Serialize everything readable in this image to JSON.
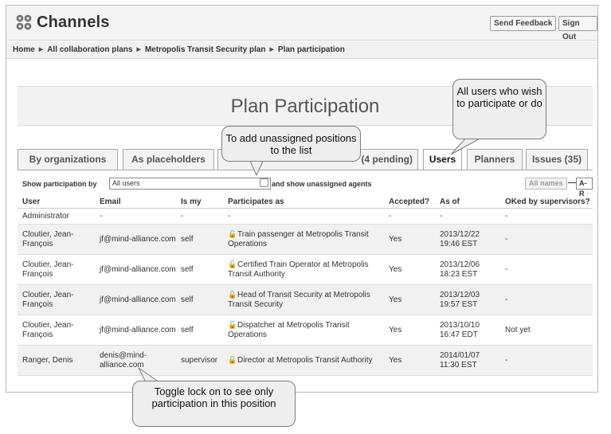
{
  "app": {
    "title": "Channels"
  },
  "header": {
    "send_feedback": "Send Feedback",
    "sign_out": "Sign Out"
  },
  "breadcrumb": [
    "Home",
    "All collaboration plans",
    "Metropolis Transit Security plan",
    "Plan participation"
  ],
  "page": {
    "title": "Plan Participation"
  },
  "tabs": [
    {
      "label": "By organizations",
      "active": false
    },
    {
      "label": "As placeholders",
      "active": false
    },
    {
      "label": "(4 pending)",
      "active": false
    },
    {
      "label": "Users",
      "active": true
    },
    {
      "label": "Planners",
      "active": false
    },
    {
      "label": "Issues (35)",
      "active": false
    }
  ],
  "controls": {
    "show_participation_label": "Show participation by",
    "selected_option": "All users",
    "unassigned_label": "and show unassigned agents",
    "all_names": "All names",
    "dash": "—",
    "range": "A-R"
  },
  "table": {
    "headers": [
      "User",
      "Email",
      "Is my",
      "Participates as",
      "Accepted?",
      "As of",
      "OKed by supervisors?"
    ],
    "rows": [
      {
        "user": "Administrator",
        "email": "-",
        "is_my": "-",
        "participates": "-",
        "accepted": "-",
        "as_of": "-",
        "oked": "-"
      },
      {
        "user": "Cloutier, Jean-François",
        "email": "jf@mind-alliance.com",
        "is_my": "self",
        "participates": "Train passenger at Metropolis Transit Operations",
        "accepted": "Yes",
        "as_of": "2013/12/22 19:46 EST",
        "oked": "-"
      },
      {
        "user": "Cloutier, Jean-François",
        "email": "jf@mind-alliance.com",
        "is_my": "self",
        "participates": "Certified Train Operator at Metropolis Transit Authority",
        "accepted": "Yes",
        "as_of": "2013/12/06 18:23 EST",
        "oked": "-"
      },
      {
        "user": "Cloutier, Jean-François",
        "email": "jf@mind-alliance.com",
        "is_my": "self",
        "participates": "Head of Transit Security at Metropolis Transit Security",
        "accepted": "Yes",
        "as_of": "2013/12/03 19:57 EST",
        "oked": "-"
      },
      {
        "user": "Cloutier, Jean-François",
        "email": "jf@mind-alliance.com",
        "is_my": "self",
        "participates": "Dispatcher at Metropolis Transit Operations",
        "accepted": "Yes",
        "as_of": "2013/10/10 16:47 EDT",
        "oked": "Not yet"
      },
      {
        "user": "Ranger, Denis",
        "email": "denis@mind-alliance.com",
        "is_my": "supervisor",
        "participates": "Director at Metropolis Transit Authority",
        "accepted": "Yes",
        "as_of": "2014/01/07 11:30 EST",
        "oked": "-"
      }
    ]
  },
  "callouts": {
    "users": "All users who wish to participate or do",
    "unassigned": "To add unassigned positions to the list",
    "lock": "Toggle lock on to see only participation in this position"
  },
  "icons": {
    "logo": "channels-logo-icon",
    "lock": "lock-icon",
    "separator": "triangle-right-icon",
    "dropdown": "triangle-down-icon"
  }
}
